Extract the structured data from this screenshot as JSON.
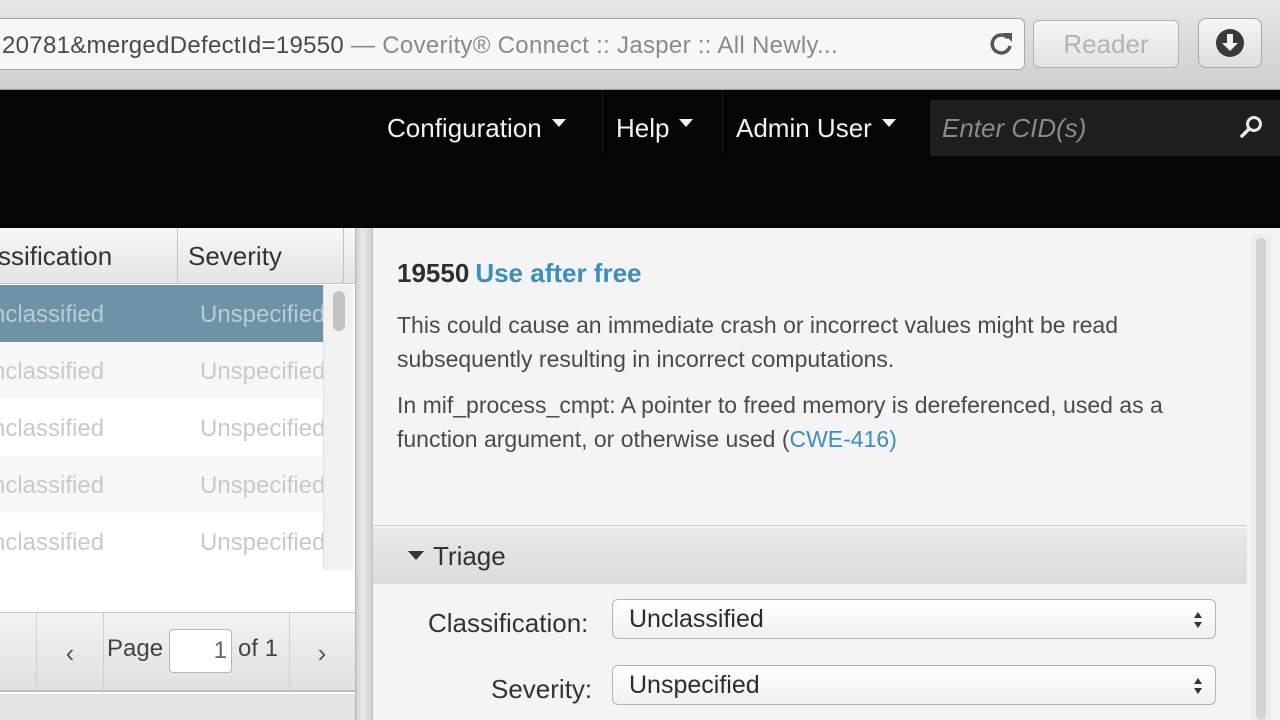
{
  "browser": {
    "url_main": "20781&mergedDefectId=19550",
    "url_title": " — Coverity® Connect :: Jasper :: All Newly...",
    "reader_label": "Reader"
  },
  "navbar": {
    "items": [
      {
        "label": "Configuration"
      },
      {
        "label": "Help"
      },
      {
        "label": "Admin User"
      }
    ],
    "search_placeholder": "Enter CID(s)"
  },
  "list": {
    "columns": [
      "ssification",
      "Severity"
    ],
    "rows": [
      {
        "classification": "nclassified",
        "severity": "Unspecified"
      },
      {
        "classification": "nclassified",
        "severity": "Unspecified"
      },
      {
        "classification": "nclassified",
        "severity": "Unspecified"
      },
      {
        "classification": "nclassified",
        "severity": "Unspecified"
      },
      {
        "classification": "nclassified",
        "severity": "Unspecified"
      }
    ],
    "pager": {
      "prev": "‹",
      "next": "›",
      "page_label": "Page",
      "page_value": "1",
      "of_label": "of 1"
    }
  },
  "defect": {
    "cid": "19550",
    "type": "Use after free",
    "description": "This could cause an immediate crash or incorrect values might be read subsequently resulting in incorrect computations.",
    "event_text": "In mif_process_cmpt: A pointer to freed memory is dereferenced, used as a function argument, or otherwise used (",
    "cwe": "CWE-416",
    "event_suffix": ")"
  },
  "triage": {
    "title": "Triage",
    "classification_label": "Classification:",
    "classification_value": "Unclassified",
    "severity_label": "Severity:",
    "severity_value": "Unspecified"
  },
  "colors": {
    "navbar": "#050505",
    "selected_row": "#6d94a6",
    "link": "#3b8ec2"
  }
}
